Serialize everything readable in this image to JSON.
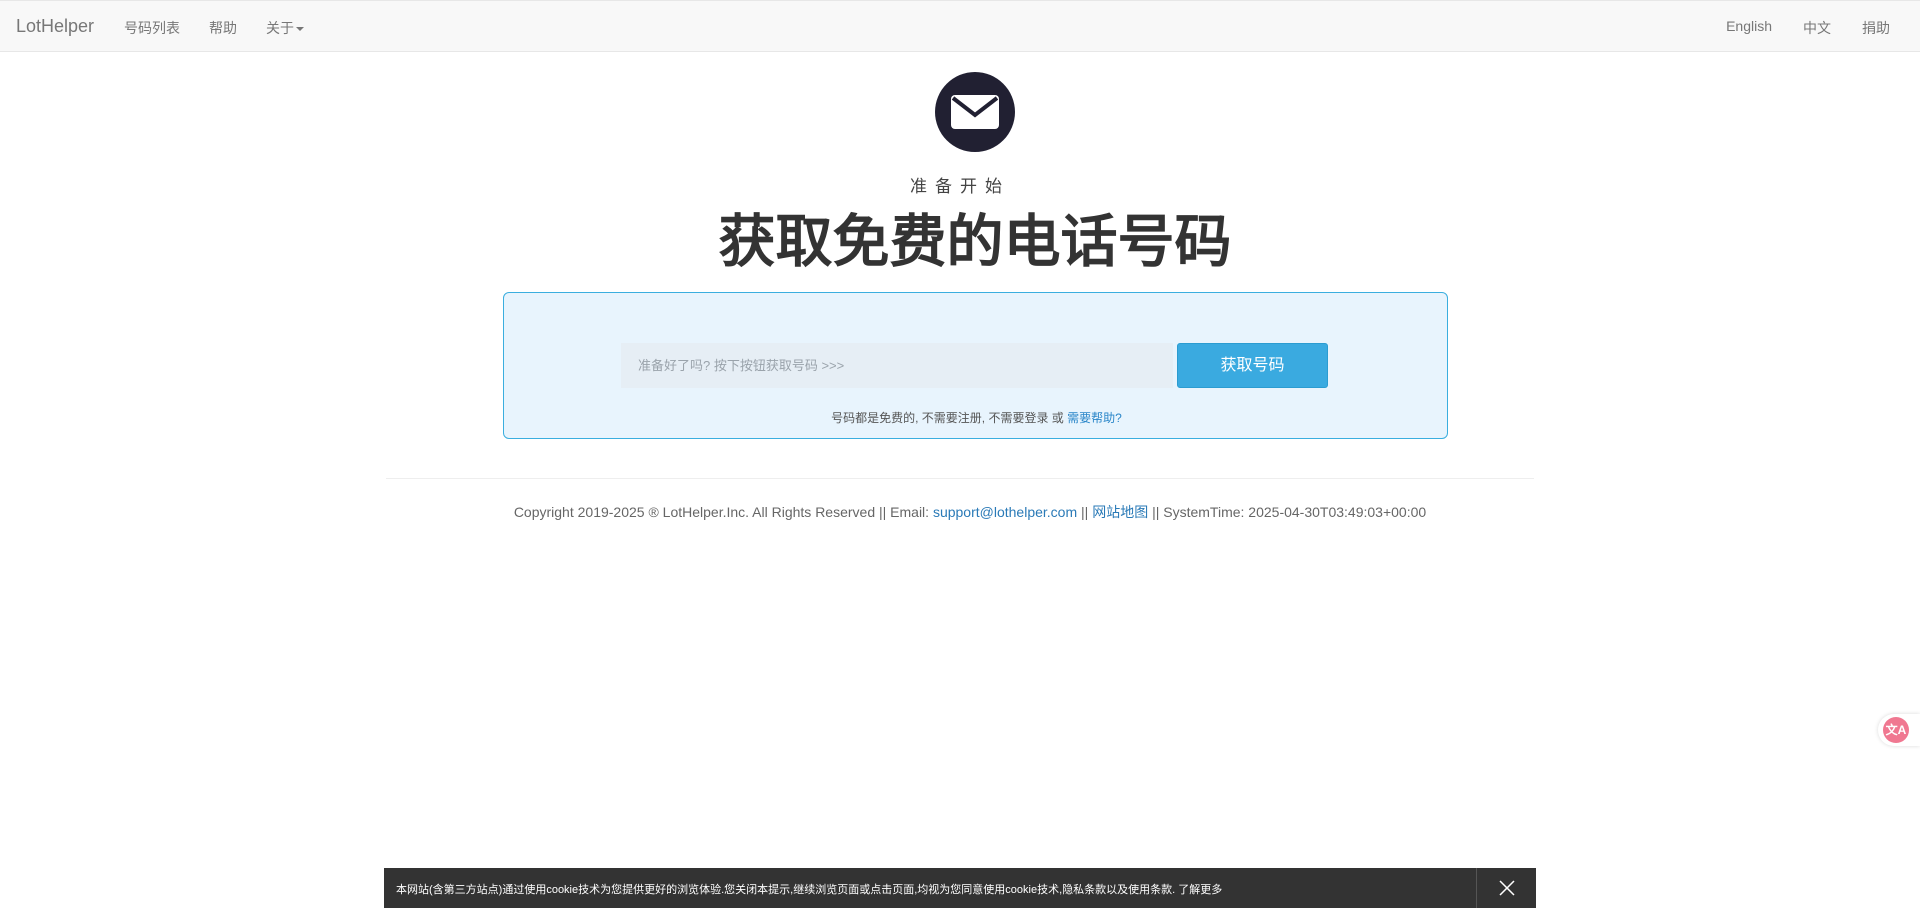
{
  "navbar": {
    "brand": "LotHelper",
    "left_items": [
      {
        "label": "号码列表"
      },
      {
        "label": "帮助"
      },
      {
        "label": "关于"
      }
    ],
    "right_items": [
      {
        "label": "English"
      },
      {
        "label": "中文"
      },
      {
        "label": "捐助"
      }
    ]
  },
  "hero": {
    "icon": "envelope-icon",
    "subtitle": "准备开始",
    "title": "获取免费的电话号码"
  },
  "panel": {
    "input_placeholder": "准备好了吗? 按下按钮获取号码 >>>",
    "button_label": "获取号码",
    "note_text": "号码都是免费的, 不需要注册, 不需要登录 或 ",
    "note_link": "需要帮助?"
  },
  "footer": {
    "copyright": "Copyright 2019-2025 ® LotHelper.Inc. All Rights Reserved || Email: ",
    "email": "support@lothelper.com",
    "sep1": " || ",
    "sitemap": "网站地图",
    "systemtime": " || SystemTime: 2025-04-30T03:49:03+00:00"
  },
  "translate_widget": {
    "icon": "translate-icon",
    "glyph": "文A",
    "color": "#f07891"
  },
  "cookie_bar": {
    "text": "本网站(含第三方站点)通过使用cookie技术为您提供更好的浏览体验.您关闭本提示,继续浏览页面或点击页面,均视为您同意使用cookie技术,隐私条款以及使用条款. 了解更多",
    "close_icon": "close-icon"
  },
  "colors": {
    "accent": "#3aaae0",
    "panel_bg": "#e8f4fd",
    "icon_circle": "#212032",
    "link": "#2a7ab7"
  }
}
